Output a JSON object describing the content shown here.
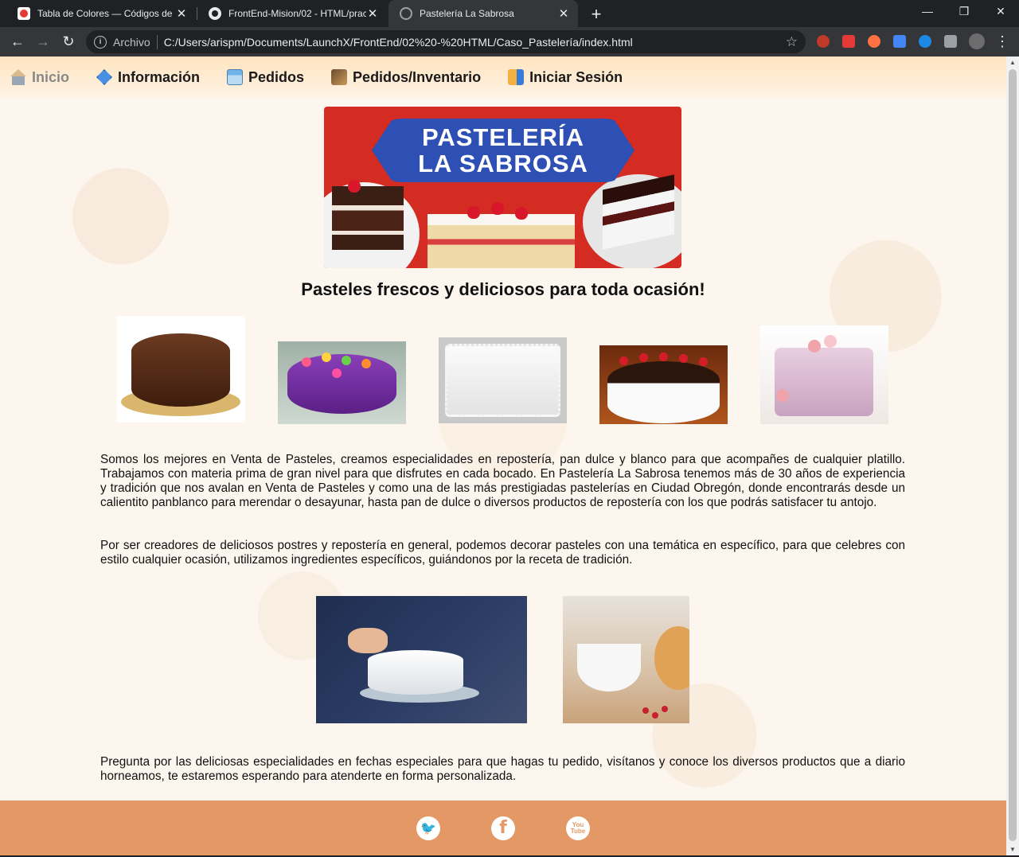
{
  "browser": {
    "tabs": [
      {
        "title": "Tabla de Colores — Códigos de C",
        "favicon": "red-circle-icon"
      },
      {
        "title": "FrontEnd-Mision/02 - HTML/prac",
        "favicon": "github-icon"
      },
      {
        "title": "Pastelería La Sabrosa",
        "favicon": "globe-icon",
        "active": true
      }
    ],
    "address": {
      "scheme_label": "Archivo",
      "url": "C:/Users/arispm/Documents/LaunchX/FrontEnd/02%20-%20HTML/Caso_Pastelería/index.html"
    }
  },
  "nav": {
    "items": [
      {
        "label": "Inicio",
        "icon": "house-icon",
        "active": true
      },
      {
        "label": "Información",
        "icon": "info-icon"
      },
      {
        "label": "Pedidos",
        "icon": "store-icon"
      },
      {
        "label": "Pedidos/Inventario",
        "icon": "inventory-icon"
      },
      {
        "label": "Iniciar Sesión",
        "icon": "login-icon"
      }
    ]
  },
  "banner": {
    "line1": "PASTELERÍA",
    "line2": "LA SABROSA"
  },
  "headline": "Pasteles frescos y deliciosos para toda ocasión!",
  "paragraphs": {
    "p1": "Somos los mejores en Venta de Pasteles, creamos especialidades en repostería, pan dulce y blanco para que acompañes de cualquier platillo. Trabajamos con materia prima de gran nivel para que disfrutes en cada bocado. En Pastelería La Sabrosa tenemos más de 30 años de experiencia y tradición que nos avalan en Venta de Pasteles y como una de las más prestigiadas pastelerías en Ciudad Obregón, donde encontrarás desde un calientito panblanco para merendar o desayunar, hasta pan de dulce o diversos productos de repostería con los que podrás satisfacer tu antojo.",
    "p2": " Por ser creadores de deliciosos postres y repostería en general, podemos decorar pasteles con una temática en específico, para que celebres con estilo cualquier ocasión, utilizamos ingredientes específicos, guiándonos por la receta de tradición.",
    "p3": "Pregunta por las deliciosas especialidades en fechas especiales para que hagas tu pedido, visítanos y conoce los diversos productos que a diario horneamos, te estaremos esperando para atenderte en forma personalizada."
  },
  "footer": {
    "social": [
      "twitter-icon",
      "facebook-icon",
      "youtube-icon"
    ],
    "youtube_line1": "You",
    "youtube_line2": "Tube"
  },
  "colors": {
    "footer": "#e39865",
    "banner_red": "#d42b23",
    "banner_blue": "#2e4fb4"
  }
}
